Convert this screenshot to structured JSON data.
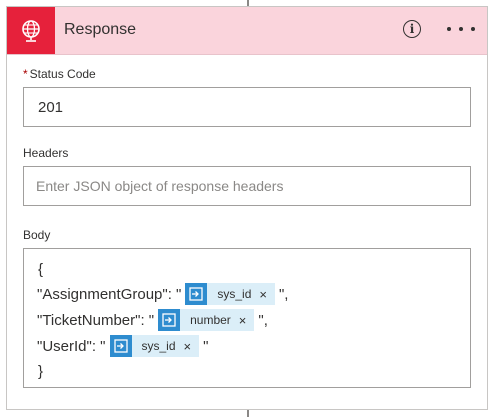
{
  "action": {
    "title": "Response",
    "icon": "globe-icon",
    "accent_color": "#e6213b",
    "header_color": "#fad4dc"
  },
  "status_code": {
    "label": "Status Code",
    "required_marker": "*",
    "value": "201"
  },
  "headers": {
    "label": "Headers",
    "placeholder": "Enter JSON object of response headers"
  },
  "body": {
    "label": "Body",
    "open_brace": "{",
    "close_brace": "}",
    "lines": [
      {
        "prefix": "\"AssignmentGroup\": \"",
        "token": "sys_id",
        "suffix": "\","
      },
      {
        "prefix": "\"TicketNumber\": \"",
        "token": "number",
        "suffix": "\","
      },
      {
        "prefix": "\"UserId\": \"",
        "token": "sys_id",
        "suffix": "\""
      }
    ],
    "token_icon": "dynamic-content-icon",
    "token_color": "#2e8ccf"
  },
  "token_remove_glyph": "×"
}
